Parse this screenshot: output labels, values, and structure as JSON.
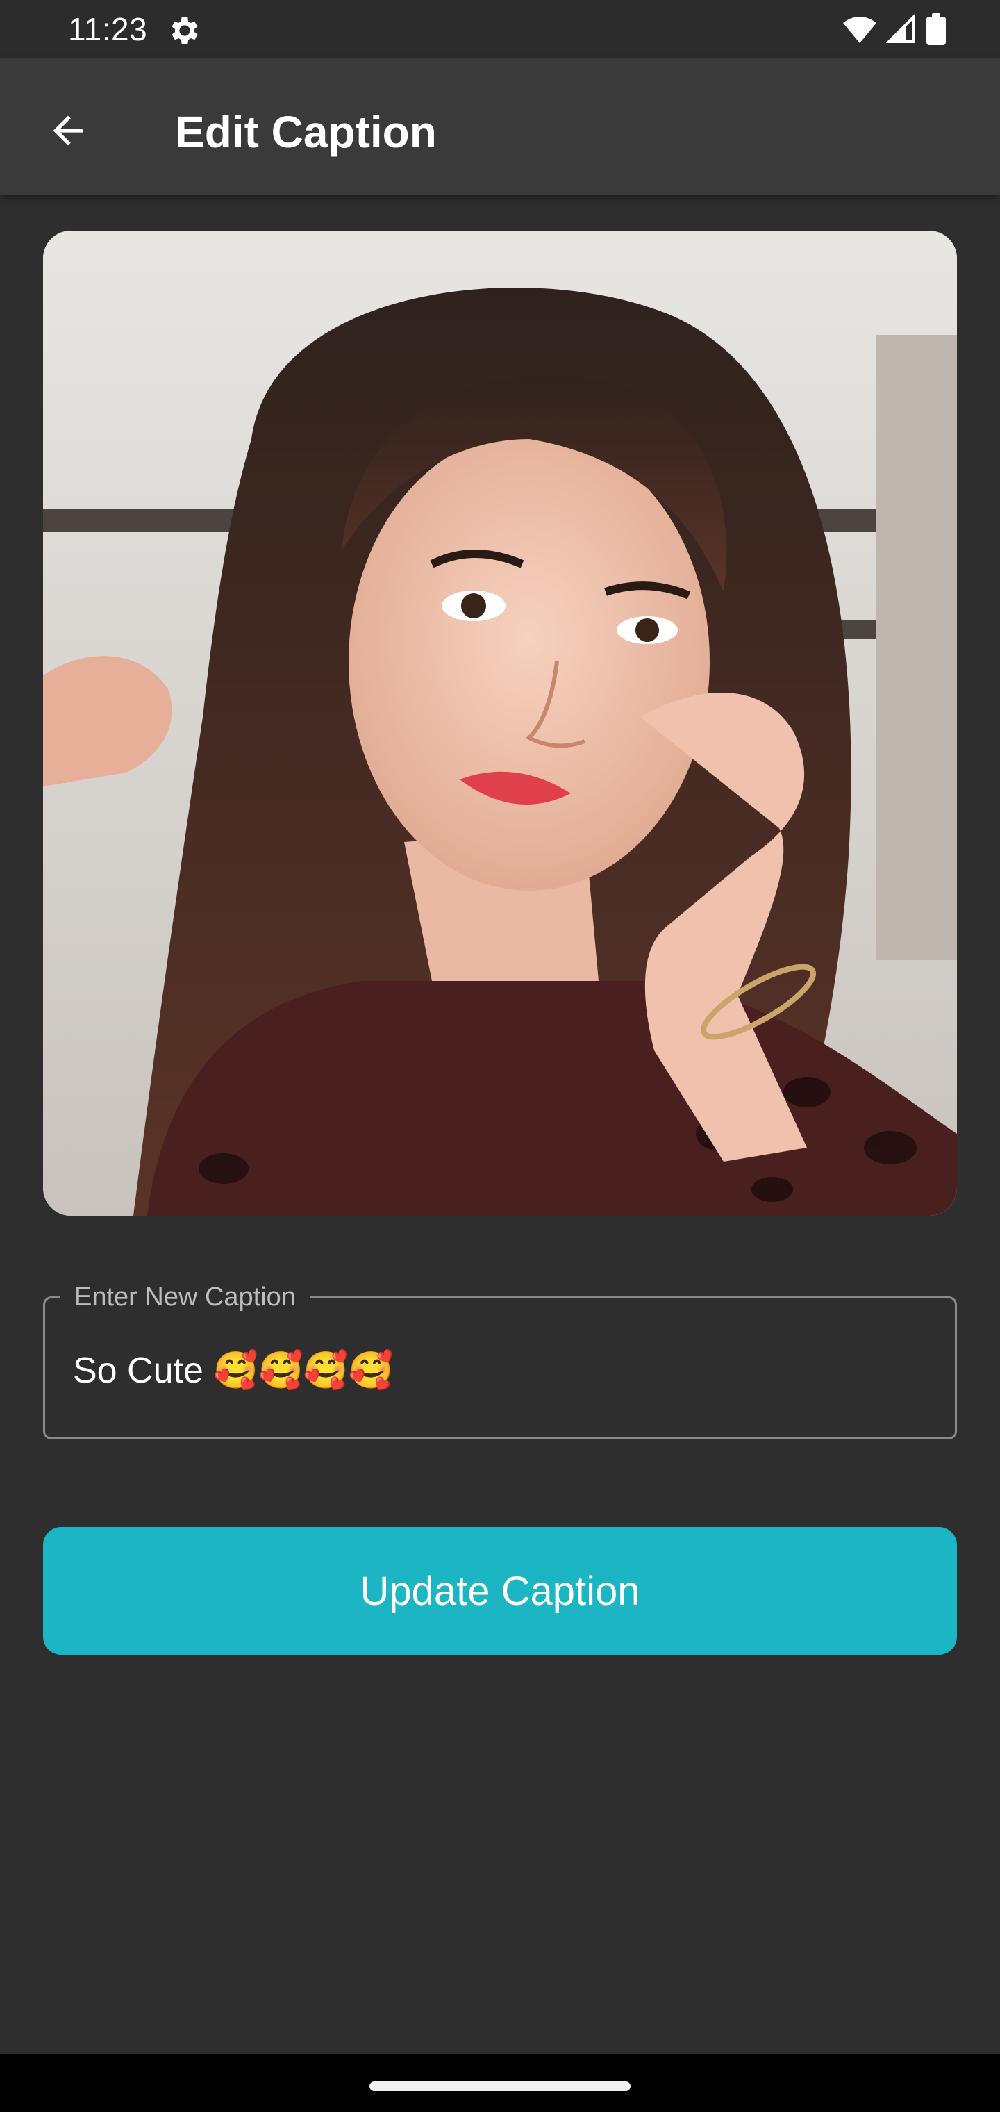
{
  "status_bar": {
    "time": "11:23",
    "left_icons": [
      "settings-gear-icon"
    ],
    "right_icons": [
      "wifi-icon",
      "cellular-signal-icon",
      "battery-icon"
    ]
  },
  "app_bar": {
    "back_icon": "arrow-left-icon",
    "title": "Edit Caption"
  },
  "photo": {
    "alt": "photo"
  },
  "caption_field": {
    "label": "Enter New Caption",
    "value": "So Cute 🥰🥰🥰🥰"
  },
  "update_button": {
    "label": "Update Caption"
  },
  "colors": {
    "background": "#2e2e2e",
    "app_bar": "#3a3a3a",
    "accent": "#1bb5c4",
    "field_border": "#8a8a8a"
  }
}
